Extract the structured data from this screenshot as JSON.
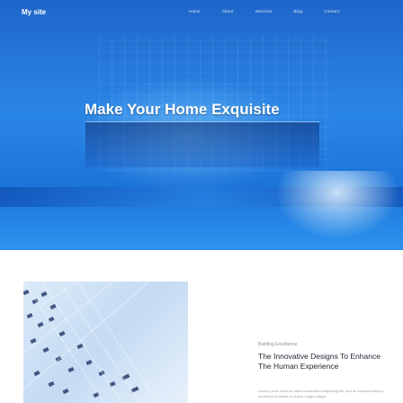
{
  "nav": {
    "brand": "My site",
    "links": [
      "Home",
      "About",
      "Services",
      "Blog",
      "Contact"
    ]
  },
  "hero": {
    "headline": "Make Your Home Exquisite"
  },
  "feature": {
    "eyebrow": "Building Excellence",
    "title": "The Innovative Designs To Enhance The Human Experience",
    "description": "Lorem ipsum dolor sit amet consectetur adipiscing elit, sed do eiusmod tempor incididunt ut labore et dolore magna aliqua."
  },
  "colors": {
    "hero_blue": "#2a86e6",
    "text_dark": "#1e2430",
    "text_muted": "#8a8f98"
  }
}
